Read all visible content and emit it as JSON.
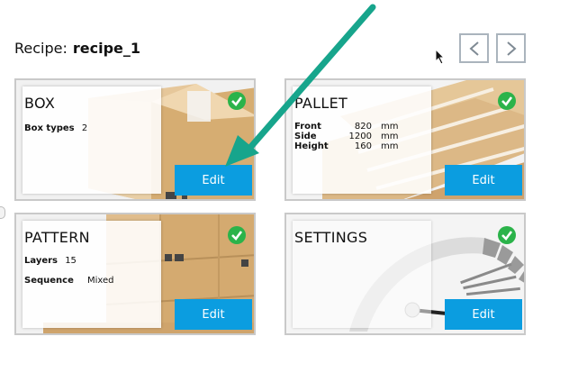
{
  "recipe": {
    "label": "Recipe:",
    "name": "recipe_1"
  },
  "nav": {
    "prev_icon": "chevron-left-icon",
    "next_icon": "chevron-right-icon"
  },
  "cards": {
    "box": {
      "title": "BOX",
      "props": [
        {
          "key": "Box types",
          "value": "2"
        }
      ],
      "edit_label": "Edit",
      "status": "check-icon"
    },
    "pallet": {
      "title": "PALLET",
      "props": [
        {
          "key": "Front",
          "value": "820",
          "unit": "mm"
        },
        {
          "key": "Side",
          "value": "1200",
          "unit": "mm"
        },
        {
          "key": "Height",
          "value": "160",
          "unit": "mm"
        }
      ],
      "edit_label": "Edit",
      "status": "check-icon"
    },
    "pattern": {
      "title": "PATTERN",
      "props": [
        {
          "key": "Layers",
          "value": "15"
        },
        {
          "key": "Sequence",
          "value": "Mixed"
        }
      ],
      "edit_label": "Edit",
      "status": "check-icon"
    },
    "settings": {
      "title": "SETTINGS",
      "edit_label": "Edit",
      "status": "check-icon"
    }
  },
  "colors": {
    "accent": "#0b9de0",
    "check": "#2bb34a",
    "arrow": "#17a58c",
    "cardboard": "#d9b98a"
  }
}
